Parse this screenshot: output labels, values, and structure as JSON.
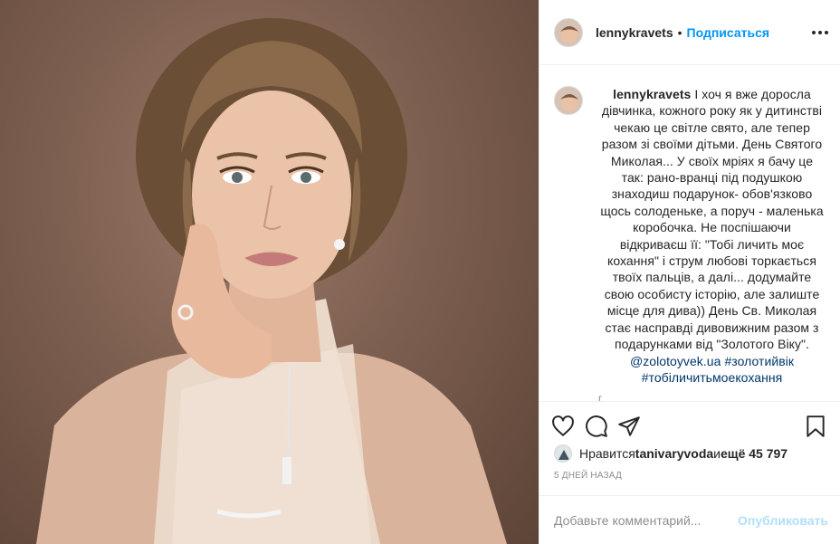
{
  "header": {
    "username": "lennykravets",
    "separator": "•",
    "follow_label": "Подписаться",
    "more_icon": "more-horizontal-icon"
  },
  "caption": {
    "username": "lennykravets",
    "text": "І хоч я вже доросла дівчинка, кожного року як у дитинстві чекаю це світле свято, але тепер разом зі своїми дітьми. День Святого Миколая... У своїх мріях я бачу це так: рано-вранці під подушкою знаходиш подарунок- обов'язково щось солоденьке, а поруч - маленька коробочка. Не поспішаючи відкриваєш її: \"Тобі личить моє кохання\" і струм любові торкається твоїх пальців, а далі... додумайте свою особисту історію, але залиште місце для дива)) День Св. Миколая стає насправді дивовижним разом з подарунками від \"Золотого Віку\". ",
    "mention": "@zolotoyvek.ua",
    "hashtags": "#золотийвік #тобіличитьмоекохання",
    "partial_next": "г"
  },
  "actions": {
    "like_icon": "heart-icon",
    "comment_icon": "comment-icon",
    "share_icon": "share-icon",
    "save_icon": "bookmark-icon"
  },
  "likes": {
    "prefix": "Нравится ",
    "user": "tanivaryvoda",
    "middle": " и ",
    "rest": "ещё 45 797"
  },
  "timestamp": "5 ДНЕЙ НАЗАД",
  "comment_box": {
    "placeholder": "Добавьте комментарий...",
    "post_label": "Опубликовать"
  }
}
